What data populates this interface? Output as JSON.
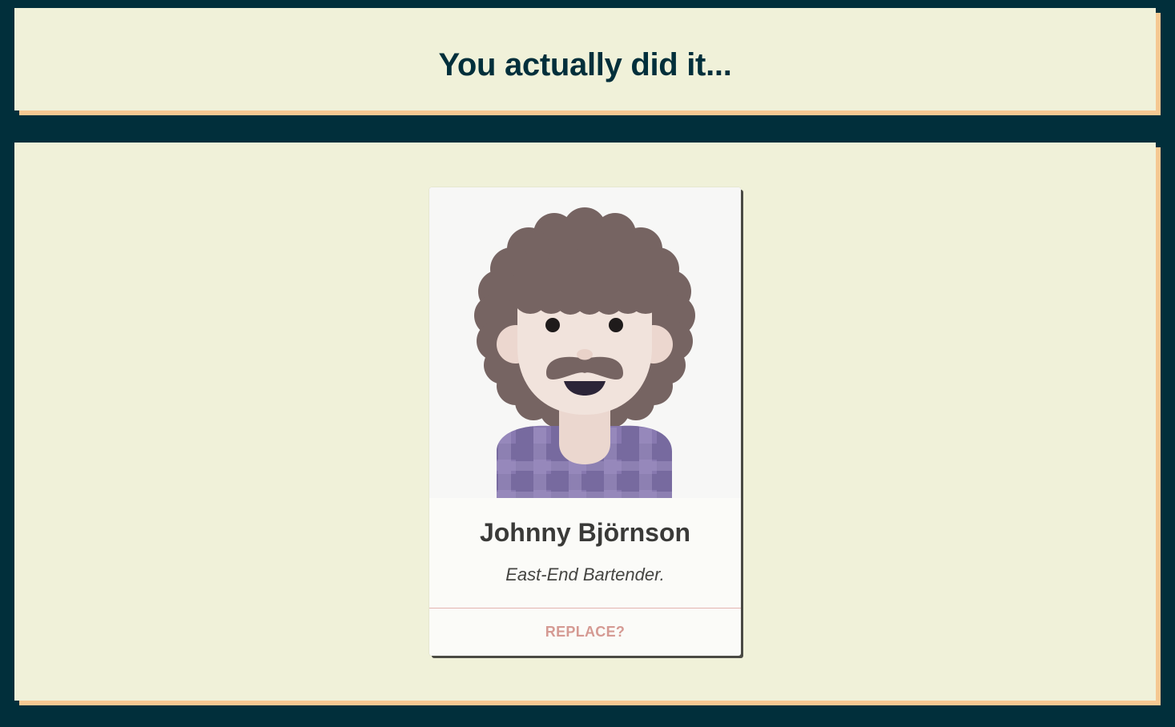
{
  "header": {
    "title": "You actually did it..."
  },
  "card": {
    "name": "Johnny Björnson",
    "role": "East-End Bartender.",
    "replace_label": "REPLACE?",
    "avatar_icon": "avatar-curly-hair-mustache-icon"
  },
  "colors": {
    "background": "#012f3b",
    "panel": "#f0f1d9",
    "panel_shadow": "#f6c892",
    "title": "#012f3b",
    "card": "#fbfbf8",
    "replace_text": "#d59a93",
    "hair": "#766462",
    "shirt": "#8879b0"
  }
}
